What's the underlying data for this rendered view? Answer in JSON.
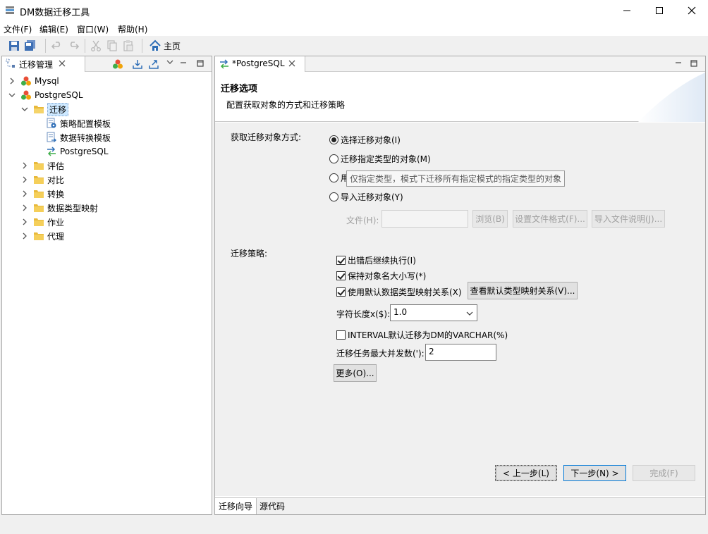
{
  "window": {
    "title": "DM数据迁移工具"
  },
  "menu": [
    "文件(F)",
    "编辑(E)",
    "窗口(W)",
    "帮助(H)"
  ],
  "toolbar": {
    "home_label": "主页"
  },
  "left_panel": {
    "tab_label": "迁移管理",
    "tree": [
      {
        "label": "Mysql"
      },
      {
        "label": "PostgreSQL"
      },
      {
        "label": "迁移"
      },
      {
        "label": "策略配置模板"
      },
      {
        "label": "数据转换模板"
      },
      {
        "label": "PostgreSQL"
      },
      {
        "label": "评估"
      },
      {
        "label": "对比"
      },
      {
        "label": "转换"
      },
      {
        "label": "数据类型映射"
      },
      {
        "label": "作业"
      },
      {
        "label": "代理"
      }
    ]
  },
  "editor": {
    "tab_label": "*PostgreSQL",
    "banner_title": "迁移选项",
    "banner_desc": "配置获取对象的方式和迁移策略",
    "fetch_label": "获取迁移对象方式:",
    "radio_options": [
      {
        "label": "选择迁移对象(I)",
        "checked": true
      },
      {
        "label": "迁移指定类型的对象(M)",
        "checked": false
      },
      {
        "label": "用",
        "checked": false
      },
      {
        "label": "导入迁移对象(Y)",
        "checked": false
      }
    ],
    "tooltip_text": "仅指定类型，模式下迁移所有指定模式的指定类型的对象",
    "file_label": "文件(H):",
    "browse_btn": "浏览(B)",
    "set_format_btn": "设置文件格式(F)...",
    "import_desc_btn": "导入文件说明(J)...",
    "strategy_label": "迁移策略:",
    "check_continue": "出错后继续执行(I)",
    "check_case": "保持对象名大小写(*)",
    "check_default_map": "使用默认数据类型映射关系(X)",
    "view_map_btn": "查看默认类型映射关系(V)...",
    "char_len_label": "字符长度x($):",
    "char_len_value": "1.0",
    "check_interval": "INTERVAL默认迁移为DM的VARCHAR(%)",
    "max_concurrency_label": "迁移任务最大并发数('):",
    "max_concurrency_value": "2",
    "more_btn": "更多(O)...",
    "prev_btn": "< 上一步(L)",
    "next_btn": "下一步(N) >",
    "finish_btn": "完成(F)",
    "bottom_tabs": [
      "迁移向导",
      "源代码"
    ]
  },
  "colors": {
    "accent": "#0078d7",
    "selection": "#cde8ff",
    "folder": "#f2c94c"
  }
}
